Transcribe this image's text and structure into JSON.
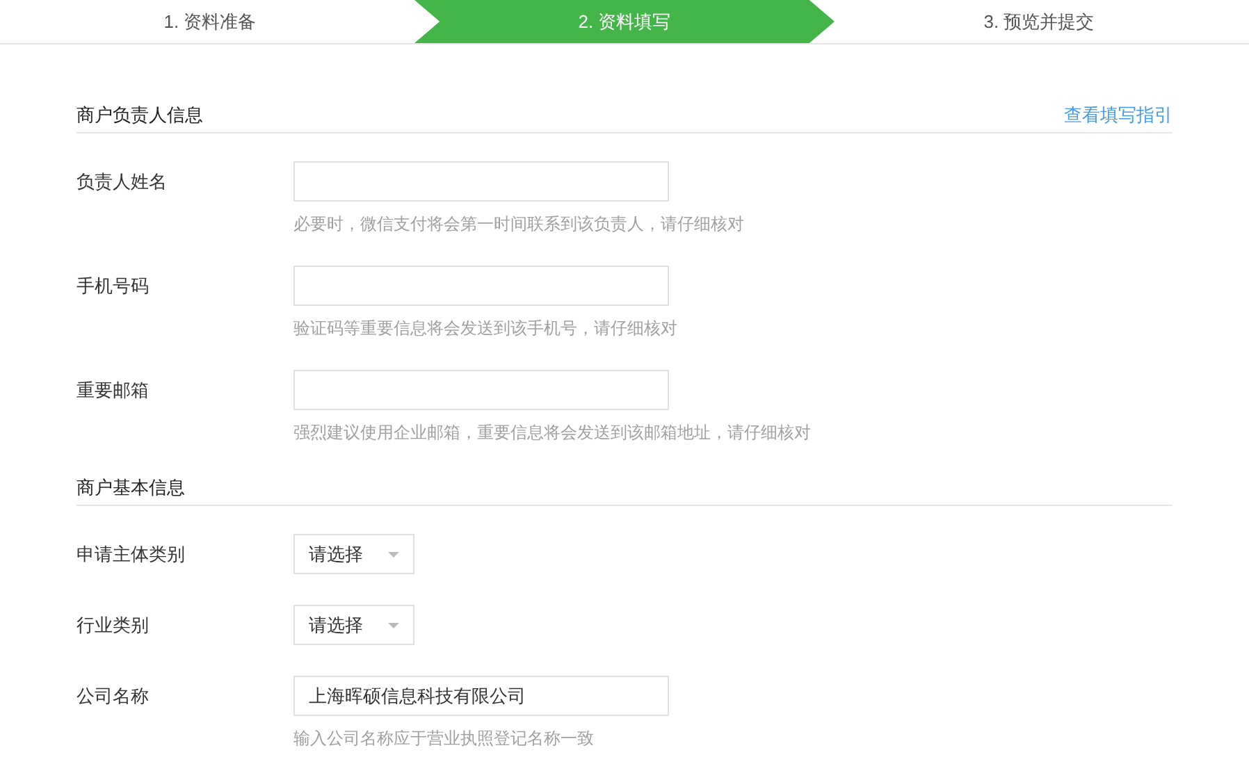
{
  "steps": [
    {
      "label": "1. 资料准备",
      "selected": false
    },
    {
      "label": "2. 资料填写",
      "selected": true
    },
    {
      "label": "3. 预览并提交",
      "selected": false
    }
  ],
  "sections": [
    {
      "title": "商户负责人信息",
      "link": "查看填写指引",
      "fields": [
        {
          "kind": "text",
          "label": "负责人姓名",
          "hint": "必要时，微信支付将会第一时间联系到该负责人，请仔细核对"
        },
        {
          "kind": "text",
          "label": "手机号码",
          "hint": "验证码等重要信息将会发送到该手机号，请仔细核对"
        },
        {
          "kind": "text",
          "label": "重要邮箱",
          "hint": "强烈建议使用企业邮箱，重要信息将会发送到该邮箱地址，请仔细核对"
        }
      ]
    },
    {
      "title": "商户基本信息",
      "fields": [
        {
          "kind": "select",
          "label": "申请主体类别",
          "value": "请选择"
        },
        {
          "kind": "select",
          "label": "行业类别",
          "value": "请选择"
        },
        {
          "kind": "text",
          "label": "公司名称",
          "value": "上海晖硕信息科技有限公司",
          "hint": "输入公司名称应于营业执照登记名称一致"
        }
      ]
    }
  ]
}
